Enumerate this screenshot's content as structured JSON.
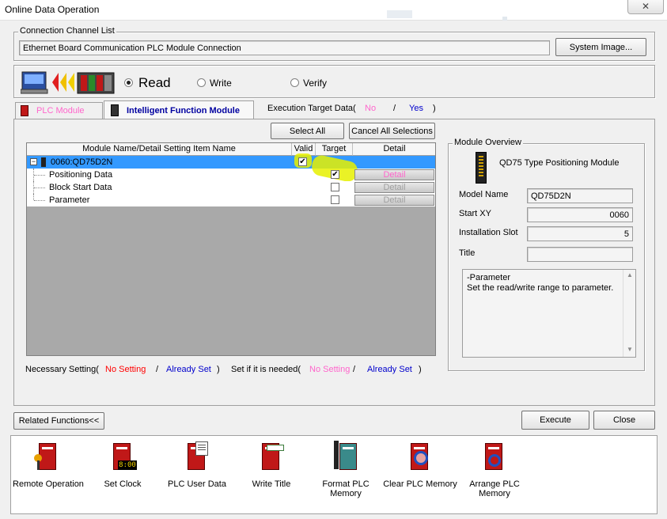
{
  "window": {
    "title": "Online Data Operation",
    "close_glyph": "✕"
  },
  "connection": {
    "group_label": "Connection Channel List",
    "value": "Ethernet Board Communication PLC Module Connection",
    "system_image_label": "System Image..."
  },
  "operation": {
    "read_label": "Read",
    "write_label": "Write",
    "verify_label": "Verify",
    "selected": "read"
  },
  "tabs": [
    {
      "label": "PLC Module",
      "active": false
    },
    {
      "label": "Intelligent Function Module",
      "active": true
    }
  ],
  "execution_target": {
    "prefix": "Execution Target Data(",
    "no": "No",
    "slash": "/",
    "yes": "Yes",
    "suffix": ")"
  },
  "actions": {
    "select_all": "Select All",
    "cancel_all": "Cancel All Selections"
  },
  "tree": {
    "columns": [
      "Module Name/Detail Setting Item Name",
      "Valid",
      "Target",
      "Detail"
    ],
    "rows": [
      {
        "name": "0060:QD75D2N",
        "valid": true,
        "target": null,
        "detail": "",
        "expander": "−"
      },
      {
        "name": "Positioning Data",
        "valid": null,
        "target": true,
        "detail": "Detail"
      },
      {
        "name": "Block Start Data",
        "valid": null,
        "target": false,
        "detail": "Detail"
      },
      {
        "name": "Parameter",
        "valid": null,
        "target": false,
        "detail": "Detail"
      }
    ]
  },
  "legend": {
    "necessary_prefix": "Necessary Setting(",
    "no_setting": "No Setting",
    "slash": "/",
    "already_set": "Already Set",
    "close": ")",
    "if_needed_prefix": "Set if it is needed(",
    "no_setting2": "No Setting",
    "already_set2": "Already Set",
    "close2": ")"
  },
  "overview": {
    "group_label": "Module Overview",
    "module_type": "QD75 Type Positioning Module",
    "model_name_label": "Model Name",
    "model_name": "QD75D2N",
    "start_xy_label": "Start XY",
    "start_xy": "0060",
    "slot_label": "Installation Slot",
    "slot": "5",
    "title_label": "Title",
    "title_value": "",
    "description_line1": "-Parameter",
    "description_line2": "Set the read/write range to parameter."
  },
  "buttons": {
    "related": "Related Functions<<",
    "execute": "Execute",
    "close": "Close"
  },
  "related_functions": [
    {
      "label": "Remote Operation",
      "label2": ""
    },
    {
      "label": "Set Clock",
      "label2": ""
    },
    {
      "label": "PLC User Data",
      "label2": ""
    },
    {
      "label": "Write Title",
      "label2": ""
    },
    {
      "label": "Format PLC",
      "label2": "Memory"
    },
    {
      "label": "Clear PLC Memory",
      "label2": ""
    },
    {
      "label": "Arrange PLC",
      "label2": "Memory"
    }
  ],
  "clock_display": "8:00",
  "colors": {
    "highlight_row": "#3399ff",
    "marker": "#e6f000",
    "red_text": "#ff0000",
    "blue_text": "#0000cc",
    "pink_text": "#ff66cc",
    "active_tab_text": "#0000a0"
  }
}
